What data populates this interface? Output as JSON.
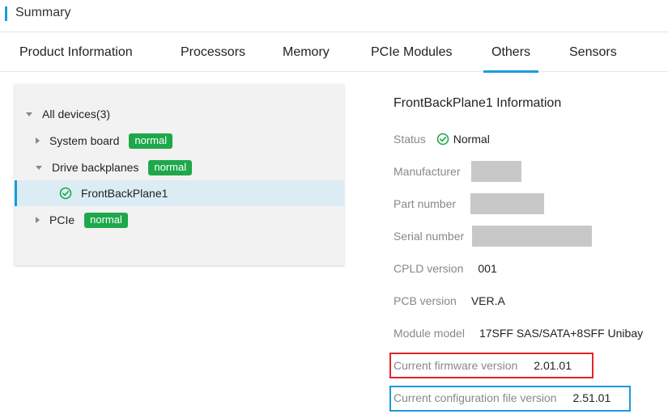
{
  "header": {
    "title": "Summary"
  },
  "tabs": [
    {
      "label": "Product Information"
    },
    {
      "label": "Processors"
    },
    {
      "label": "Memory"
    },
    {
      "label": "PCIe Modules"
    },
    {
      "label": "Others",
      "active": true
    },
    {
      "label": "Sensors"
    }
  ],
  "tree": {
    "root_label": "All devices(3)",
    "system_board": {
      "label": "System board",
      "status": "normal"
    },
    "drive_backplanes": {
      "label": "Drive backplanes",
      "status": "normal"
    },
    "front_back_plane": {
      "label": "FrontBackPlane1",
      "selected": true
    },
    "pcie": {
      "label": "PCIe",
      "status": "normal"
    }
  },
  "details": {
    "title": "FrontBackPlane1 Information",
    "status": {
      "label": "Status",
      "value": "Normal"
    },
    "manufacturer": {
      "label": "Manufacturer"
    },
    "part_number": {
      "label": "Part number"
    },
    "serial_number": {
      "label": "Serial number"
    },
    "cpld_version": {
      "label": "CPLD version",
      "value": "001"
    },
    "pcb_version": {
      "label": "PCB version",
      "value": "VER.A"
    },
    "module_model": {
      "label": "Module model",
      "value": "17SFF SAS/SATA+8SFF Unibay"
    },
    "firmware_version": {
      "label": "Current firmware version",
      "value": "2.01.01"
    },
    "config_file_version": {
      "label": "Current configuration file version",
      "value": "2.51.01"
    }
  },
  "colors": {
    "accent": "#1a9cdc",
    "status_normal": "#1ea84b",
    "highlight_red": "#e0252b",
    "highlight_blue": "#1a9cdc"
  },
  "icons": {
    "status_ok": "check-circle-icon",
    "collapse": "caret-down-icon",
    "expand": "caret-right-icon"
  }
}
